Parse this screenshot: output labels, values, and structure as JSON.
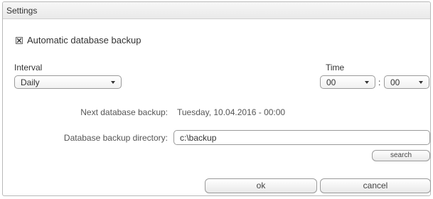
{
  "window": {
    "title": "Settings"
  },
  "backup": {
    "auto_label": "Automatic database backup",
    "auto_checked": true
  },
  "interval": {
    "label": "Interval",
    "value": "Daily"
  },
  "time": {
    "label": "Time",
    "hour": "00",
    "separator": ":",
    "minute": "00"
  },
  "next": {
    "label": "Next database backup:",
    "value": "Tuesday, 10.04.2016 - 00:00"
  },
  "directory": {
    "label": "Database backup directory:",
    "value": "c:\\backup"
  },
  "buttons": {
    "search": "search",
    "ok": "ok",
    "cancel": "cancel"
  },
  "icons": {
    "checkbox": "checkbox-checked-icon",
    "dropdown": "chevron-down-icon"
  }
}
